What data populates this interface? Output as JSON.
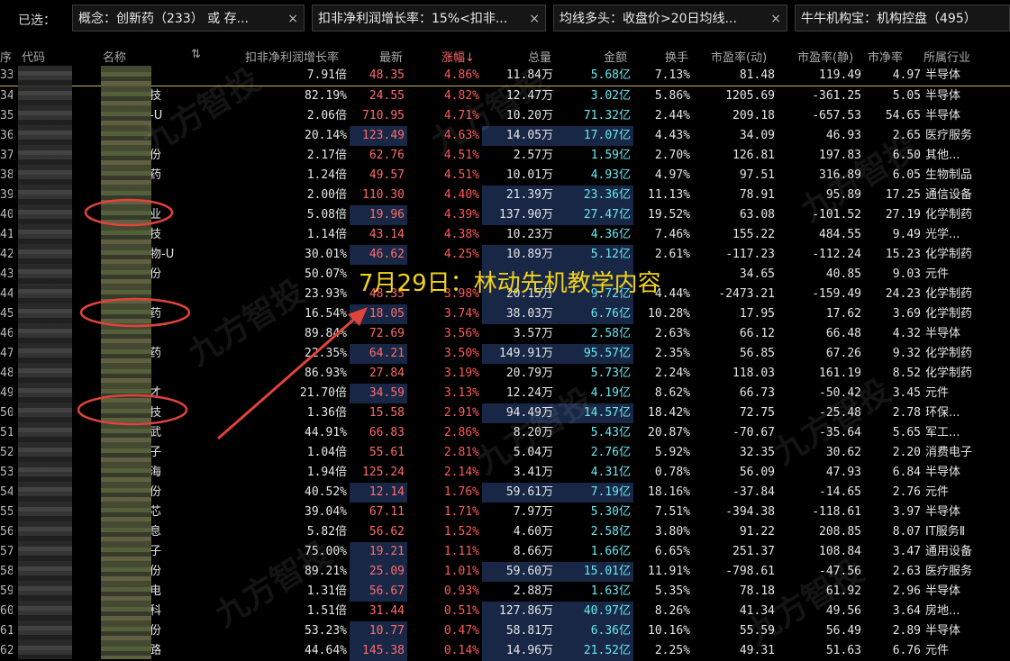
{
  "filter_bar": {
    "label": "已选：",
    "chips": [
      {
        "text": "概念：创新药（233） 或 存...",
        "close": "×"
      },
      {
        "text": "扣非净利润增长率：15%<扣非...",
        "close": "×"
      },
      {
        "text": "均线多头：收盘价>20日均线...",
        "close": "×"
      },
      {
        "text": "牛牛机构宝：机构控盘（495）",
        "close": "×"
      }
    ]
  },
  "columns": {
    "seq": "序",
    "code": "代码",
    "name": "名称",
    "sort_icon": "⇅",
    "growth": "扣非净利润增长率",
    "latest": "最新",
    "change": "涨幅↓",
    "volume": "总量",
    "amount": "金额",
    "turnover": "换手",
    "pe_dynamic": "市盈率(动)",
    "pe_static": "市盈率(静)",
    "pb": "市净率",
    "industry": "所属行业"
  },
  "rows": [
    {
      "seq": "33",
      "name_tail": "",
      "growth": "7.91倍",
      "latest": "48.35",
      "change": "4.86%",
      "volume": "11.84万",
      "amount": "5.68亿",
      "turnover": "7.13%",
      "pe_dyn": "81.48",
      "pe_st": "119.49",
      "pb": "4.97",
      "industry": "半导体"
    },
    {
      "seq": "34",
      "name_tail": "技",
      "growth": "82.19%",
      "latest": "24.55",
      "change": "4.82%",
      "volume": "12.47万",
      "amount": "3.02亿",
      "turnover": "5.86%",
      "pe_dyn": "1205.69",
      "pe_st": "-361.25",
      "pb": "5.05",
      "industry": "半导体"
    },
    {
      "seq": "35",
      "name_tail": "-U",
      "growth": "2.06倍",
      "latest": "710.95",
      "change": "4.71%",
      "volume": "10.20万",
      "amount": "71.32亿",
      "turnover": "2.44%",
      "pe_dyn": "209.18",
      "pe_st": "-657.53",
      "pb": "54.65",
      "industry": "半导体"
    },
    {
      "seq": "36",
      "name_tail": "",
      "growth": "20.14%",
      "latest": "123.49",
      "change": "4.63%",
      "volume": "14.05万",
      "amount": "17.07亿",
      "turnover": "4.43%",
      "pe_dyn": "34.09",
      "pe_st": "46.93",
      "pb": "2.65",
      "industry": "医疗服务"
    },
    {
      "seq": "37",
      "name_tail": "份",
      "growth": "2.17倍",
      "latest": "62.76",
      "change": "4.51%",
      "volume": "2.57万",
      "amount": "1.59亿",
      "turnover": "2.70%",
      "pe_dyn": "126.81",
      "pe_st": "197.83",
      "pb": "6.50",
      "industry": "其他..."
    },
    {
      "seq": "38",
      "name_tail": "药",
      "growth": "1.24倍",
      "latest": "49.57",
      "change": "4.51%",
      "volume": "10.01万",
      "amount": "4.93亿",
      "turnover": "4.97%",
      "pe_dyn": "97.51",
      "pe_st": "316.89",
      "pb": "6.05",
      "industry": "生物制品"
    },
    {
      "seq": "39",
      "name_tail": "",
      "growth": "2.00倍",
      "latest": "110.30",
      "change": "4.40%",
      "volume": "21.39万",
      "amount": "23.36亿",
      "turnover": "11.13%",
      "pe_dyn": "78.91",
      "pe_st": "95.89",
      "pb": "17.25",
      "industry": "通信设备"
    },
    {
      "seq": "40",
      "name_tail": "业",
      "growth": "5.08倍",
      "latest": "19.96",
      "change": "4.39%",
      "volume": "137.90万",
      "amount": "27.47亿",
      "turnover": "19.52%",
      "pe_dyn": "63.08",
      "pe_st": "-101.52",
      "pb": "27.19",
      "industry": "化学制药"
    },
    {
      "seq": "41",
      "name_tail": "技",
      "growth": "1.14倍",
      "latest": "43.14",
      "change": "4.38%",
      "volume": "10.23万",
      "amount": "4.36亿",
      "turnover": "7.46%",
      "pe_dyn": "155.22",
      "pe_st": "484.55",
      "pb": "9.49",
      "industry": "光学..."
    },
    {
      "seq": "42",
      "name_tail": "物-U",
      "growth": "30.01%",
      "latest": "46.62",
      "change": "4.25%",
      "volume": "10.89万",
      "amount": "5.12亿",
      "turnover": "2.61%",
      "pe_dyn": "-117.23",
      "pe_st": "-112.24",
      "pb": "15.23",
      "industry": "化学制药"
    },
    {
      "seq": "43",
      "name_tail": "份",
      "growth": "50.07%",
      "latest": "",
      "change": "",
      "volume": "",
      "amount": "",
      "turnover": "",
      "pe_dyn": "34.65",
      "pe_st": "40.85",
      "pb": "9.03",
      "industry": "元件"
    },
    {
      "seq": "44",
      "name_tail": "",
      "growth": "23.93%",
      "latest": "48.35",
      "change": "3.98%",
      "volume": "20.15万",
      "amount": "9.72亿",
      "turnover": "4.44%",
      "pe_dyn": "-2473.21",
      "pe_st": "-159.49",
      "pb": "24.23",
      "industry": "化学制药"
    },
    {
      "seq": "45",
      "name_tail": "药",
      "growth": "16.54%",
      "latest": "18.05",
      "change": "3.74%",
      "volume": "38.03万",
      "amount": "6.76亿",
      "turnover": "10.28%",
      "pe_dyn": "17.95",
      "pe_st": "17.62",
      "pb": "3.69",
      "industry": "化学制药"
    },
    {
      "seq": "46",
      "name_tail": "",
      "growth": "89.84%",
      "latest": "72.69",
      "change": "3.56%",
      "volume": "3.57万",
      "amount": "2.58亿",
      "turnover": "2.63%",
      "pe_dyn": "66.12",
      "pe_st": "66.48",
      "pb": "4.32",
      "industry": "半导体"
    },
    {
      "seq": "47",
      "name_tail": "药",
      "growth": "22.35%",
      "latest": "64.21",
      "change": "3.50%",
      "volume": "149.91万",
      "amount": "95.57亿",
      "turnover": "2.35%",
      "pe_dyn": "56.85",
      "pe_st": "67.26",
      "pb": "9.32",
      "industry": "化学制药"
    },
    {
      "seq": "48",
      "name_tail": "",
      "growth": "86.93%",
      "latest": "27.84",
      "change": "3.19%",
      "volume": "20.79万",
      "amount": "5.73亿",
      "turnover": "2.24%",
      "pe_dyn": "118.03",
      "pe_st": "161.19",
      "pb": "8.52",
      "industry": "化学制药"
    },
    {
      "seq": "49",
      "name_tail": "才",
      "growth": "21.70倍",
      "latest": "34.59",
      "change": "3.13%",
      "volume": "12.24万",
      "amount": "4.19亿",
      "turnover": "8.62%",
      "pe_dyn": "66.73",
      "pe_st": "-50.42",
      "pb": "3.45",
      "industry": "元件"
    },
    {
      "seq": "50",
      "name_tail": "技",
      "growth": "1.36倍",
      "latest": "15.58",
      "change": "2.91%",
      "volume": "94.49万",
      "amount": "14.57亿",
      "turnover": "18.42%",
      "pe_dyn": "72.75",
      "pe_st": "-25.48",
      "pb": "2.78",
      "industry": "环保..."
    },
    {
      "seq": "51",
      "name_tail": "武",
      "growth": "44.91%",
      "latest": "66.83",
      "change": "2.86%",
      "volume": "8.20万",
      "amount": "5.43亿",
      "turnover": "20.87%",
      "pe_dyn": "-70.67",
      "pe_st": "-35.64",
      "pb": "5.65",
      "industry": "军工..."
    },
    {
      "seq": "52",
      "name_tail": "子",
      "growth": "1.04倍",
      "latest": "55.61",
      "change": "2.81%",
      "volume": "5.04万",
      "amount": "2.76亿",
      "turnover": "5.92%",
      "pe_dyn": "32.35",
      "pe_st": "30.62",
      "pb": "2.20",
      "industry": "消费电子"
    },
    {
      "seq": "53",
      "name_tail": "海",
      "growth": "1.94倍",
      "latest": "125.24",
      "change": "2.14%",
      "volume": "3.41万",
      "amount": "4.31亿",
      "turnover": "0.78%",
      "pe_dyn": "56.09",
      "pe_st": "47.93",
      "pb": "6.84",
      "industry": "半导体"
    },
    {
      "seq": "54",
      "name_tail": "份",
      "growth": "40.52%",
      "latest": "12.14",
      "change": "1.76%",
      "volume": "59.61万",
      "amount": "7.19亿",
      "turnover": "18.16%",
      "pe_dyn": "-37.84",
      "pe_st": "-14.65",
      "pb": "2.76",
      "industry": "元件"
    },
    {
      "seq": "55",
      "name_tail": "芯",
      "growth": "39.04%",
      "latest": "67.11",
      "change": "1.71%",
      "volume": "7.97万",
      "amount": "5.30亿",
      "turnover": "7.51%",
      "pe_dyn": "-394.38",
      "pe_st": "-118.61",
      "pb": "3.97",
      "industry": "半导体"
    },
    {
      "seq": "56",
      "name_tail": "息",
      "growth": "5.82倍",
      "latest": "56.62",
      "change": "1.52%",
      "volume": "4.60万",
      "amount": "2.58亿",
      "turnover": "3.80%",
      "pe_dyn": "91.22",
      "pe_st": "208.85",
      "pb": "8.07",
      "industry": "IT服务Ⅱ"
    },
    {
      "seq": "57",
      "name_tail": "子",
      "growth": "75.00%",
      "latest": "19.21",
      "change": "1.11%",
      "volume": "8.66万",
      "amount": "1.66亿",
      "turnover": "6.65%",
      "pe_dyn": "251.37",
      "pe_st": "108.84",
      "pb": "3.47",
      "industry": "通用设备"
    },
    {
      "seq": "58",
      "name_tail": "份",
      "growth": "89.21%",
      "latest": "25.09",
      "change": "1.01%",
      "volume": "59.60万",
      "amount": "15.01亿",
      "turnover": "11.91%",
      "pe_dyn": "-798.61",
      "pe_st": "-47.56",
      "pb": "2.63",
      "industry": "医疗服务"
    },
    {
      "seq": "59",
      "name_tail": "电",
      "growth": "1.31倍",
      "latest": "56.67",
      "change": "0.93%",
      "volume": "2.88万",
      "amount": "1.63亿",
      "turnover": "5.35%",
      "pe_dyn": "78.18",
      "pe_st": "61.92",
      "pb": "2.96",
      "industry": "半导体"
    },
    {
      "seq": "60",
      "name_tail": "科",
      "growth": "1.51倍",
      "latest": "31.44",
      "change": "0.51%",
      "volume": "127.86万",
      "amount": "40.97亿",
      "turnover": "8.26%",
      "pe_dyn": "41.34",
      "pe_st": "49.56",
      "pb": "3.64",
      "industry": "房地..."
    },
    {
      "seq": "61",
      "name_tail": "份",
      "growth": "53.23%",
      "latest": "10.77",
      "change": "0.47%",
      "volume": "58.81万",
      "amount": "6.36亿",
      "turnover": "10.16%",
      "pe_dyn": "55.59",
      "pe_st": "56.49",
      "pb": "2.89",
      "industry": "半导体"
    },
    {
      "seq": "62",
      "name_tail": "路",
      "growth": "44.64%",
      "latest": "145.38",
      "change": "0.14%",
      "volume": "14.96万",
      "amount": "21.52亿",
      "turnover": "2.25%",
      "pe_dyn": "49.31",
      "pe_st": "51.63",
      "pb": "6.76",
      "industry": "元件"
    }
  ],
  "overlay_caption": "7月29日：林动先机教学内容",
  "watermark": "九方智投",
  "colors": {
    "up_red": "#ff5a5a",
    "amount_cyan": "#67e8f0",
    "highlight_bg": "#182746",
    "caption_yellow": "#f2d21a",
    "annotation_red": "#e0433a"
  }
}
